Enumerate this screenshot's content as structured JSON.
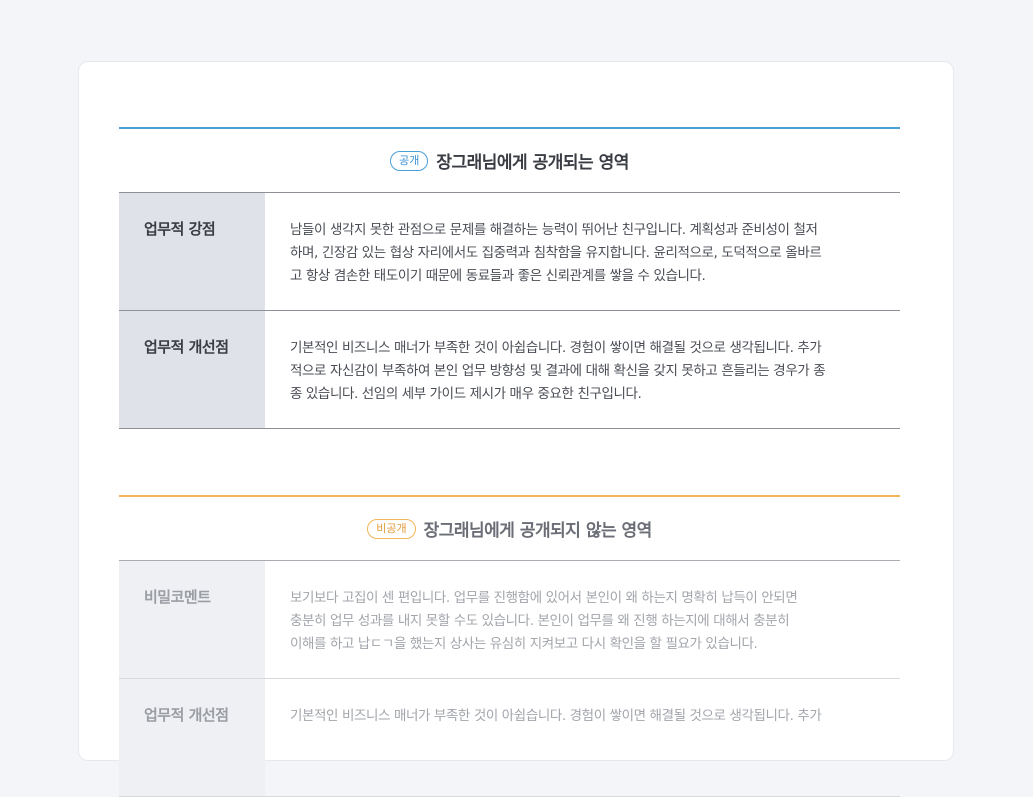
{
  "public_section": {
    "badge": "공개",
    "title": "장그래님에게 공개되는 영역",
    "accent_color": "#4a9fd8",
    "rows": [
      {
        "label": "업무적 강점",
        "lines": [
          "남들이 생각지 못한 관점으로 문제를 해결하는 능력이 뛰어난 친구입니다. 계획성과 준비성이 철저",
          "하며, 긴장감 있는 협상 자리에서도 집중력과 침착함을 유지합니다. 윤리적으로, 도덕적으로 올바르",
          "고 항상 겸손한 태도이기 때문에 동료들과 좋은 신뢰관계를 쌓을 수 있습니다."
        ]
      },
      {
        "label": "업무적 개선점",
        "lines": [
          "기본적인 비즈니스 매너가 부족한 것이 아쉽습니다. 경험이 쌓이면 해결될 것으로 생각됩니다. 추가",
          "적으로 자신감이 부족하여 본인 업무 방향성 및 결과에 대해 확신을 갖지 못하고 흔들리는 경우가 종",
          "종 있습니다. 선임의 세부 가이드 제시가 매우 중요한 친구입니다."
        ]
      }
    ]
  },
  "private_section": {
    "badge": "비공개",
    "title": "장그래님에게 공개되지 않는 영역",
    "accent_color": "#f2b55a",
    "rows": [
      {
        "label": "비밀코멘트",
        "lines": [
          "보기보다 고집이 센 편입니다. 업무를 진행함에 있어서 본인이 왜 하는지 명확히 납득이 안되면",
          "충분히 업무 성과를 내지 못할 수도 있습니다. 본인이 업무를 왜 진행 하는지에 대해서 충분히",
          "이해를 하고 납ㄷㄱ을 했는지 상사는 유심히 지켜보고 다시 확인을 할 필요가 있습니다."
        ]
      },
      {
        "label": "업무적 개선점",
        "lines": [
          "기본적인 비즈니스 매너가 부족한 것이 아쉽습니다. 경험이 쌓이면 해결될 것으로 생각됩니다. 추가"
        ]
      }
    ]
  }
}
